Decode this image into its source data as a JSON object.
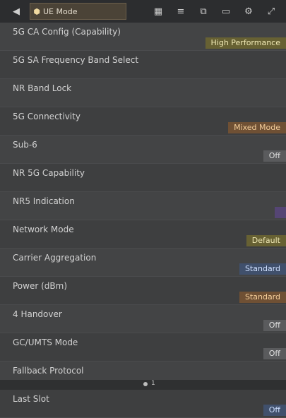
{
  "toolbar": {
    "tab_label": "UE Mode",
    "icons": [
      "back-icon",
      "grid-icon",
      "list-icon",
      "copy-icon",
      "screen-icon",
      "settings-icon",
      "expand-icon"
    ]
  },
  "settings": [
    {
      "label": "5G CA Config (Capability)",
      "value": "High Performance",
      "accent": "yellow"
    },
    {
      "label": "5G SA Frequency Band Select",
      "value": "",
      "accent": "none"
    },
    {
      "label": "NR Band Lock",
      "value": "",
      "accent": "none"
    },
    {
      "label": "5G Connectivity",
      "value": "Mixed Mode",
      "accent": "orange"
    },
    {
      "label": "Sub-6",
      "value": "Off",
      "accent": "gray"
    },
    {
      "label": "NR 5G Capability",
      "value": "",
      "accent": "none"
    },
    {
      "label": "NR5 Indication",
      "value": "",
      "accent": "purple"
    },
    {
      "label": "Network Mode",
      "value": "Default",
      "accent": "yellow"
    },
    {
      "label": "Carrier Aggregation",
      "value": "Standard",
      "accent": "blue"
    },
    {
      "label": "Power (dBm)",
      "value": "Standard",
      "accent": "orange"
    },
    {
      "label": "4 Handover",
      "value": "Off",
      "accent": "gray"
    },
    {
      "label": "GC/UMTS Mode",
      "value": "Off",
      "accent": "gray"
    },
    {
      "label": "Fallback Protocol",
      "value": "",
      "accent": "none"
    },
    {
      "label": "Last Slot",
      "value": "Off",
      "accent": "blue"
    }
  ],
  "page_indicator": "1",
  "colors": {
    "background": "#3e3f40",
    "topbar": "#2c2d2f",
    "yellow": "#676133",
    "orange": "#6f5034",
    "blue": "#40506c",
    "purple": "#554574"
  }
}
